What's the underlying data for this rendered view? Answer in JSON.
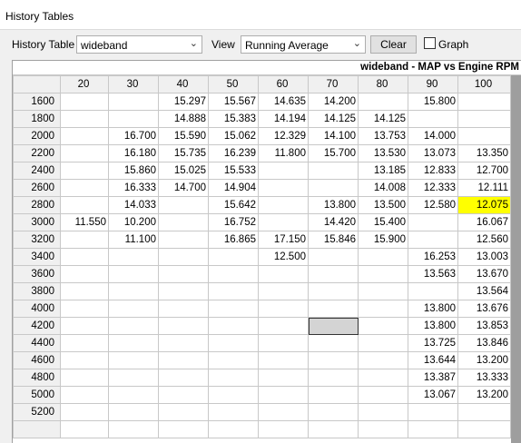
{
  "window": {
    "title": "History Tables"
  },
  "toolbar": {
    "history_table_label": "History Table",
    "history_table_value": "wideband",
    "view_label": "View",
    "view_value": "Running Average",
    "clear_label": "Clear",
    "graph_label": "Graph",
    "graph_checked": false
  },
  "table": {
    "caption": "wideband - MAP vs Engine RPM",
    "columns": [
      "20",
      "30",
      "40",
      "50",
      "60",
      "70",
      "80",
      "90",
      "100"
    ],
    "highlight_color": "#ffff00",
    "highlighted_cell": {
      "row": "2800",
      "col": "100"
    },
    "selected_cell": {
      "row": "4200",
      "col": "70"
    },
    "rows": [
      {
        "label": "1600",
        "cells": [
          "",
          "",
          "15.297",
          "15.567",
          "14.635",
          "14.200",
          "",
          "15.800",
          ""
        ]
      },
      {
        "label": "1800",
        "cells": [
          "",
          "",
          "14.888",
          "15.383",
          "14.194",
          "14.125",
          "14.125",
          "",
          ""
        ]
      },
      {
        "label": "2000",
        "cells": [
          "",
          "16.700",
          "15.590",
          "15.062",
          "12.329",
          "14.100",
          "13.753",
          "14.000",
          ""
        ]
      },
      {
        "label": "2200",
        "cells": [
          "",
          "16.180",
          "15.735",
          "16.239",
          "11.800",
          "15.700",
          "13.530",
          "13.073",
          "13.350"
        ]
      },
      {
        "label": "2400",
        "cells": [
          "",
          "15.860",
          "15.025",
          "15.533",
          "",
          "",
          "13.185",
          "12.833",
          "12.700"
        ]
      },
      {
        "label": "2600",
        "cells": [
          "",
          "16.333",
          "14.700",
          "14.904",
          "",
          "",
          "14.008",
          "12.333",
          "12.111"
        ]
      },
      {
        "label": "2800",
        "cells": [
          "",
          "14.033",
          "",
          "15.642",
          "",
          "13.800",
          "13.500",
          "12.580",
          "12.075"
        ]
      },
      {
        "label": "3000",
        "cells": [
          "11.550",
          "10.200",
          "",
          "16.752",
          "",
          "14.420",
          "15.400",
          "",
          "16.067"
        ]
      },
      {
        "label": "3200",
        "cells": [
          "",
          "11.100",
          "",
          "16.865",
          "17.150",
          "15.846",
          "15.900",
          "",
          "12.560"
        ]
      },
      {
        "label": "3400",
        "cells": [
          "",
          "",
          "",
          "",
          "12.500",
          "",
          "",
          "16.253",
          "13.003"
        ]
      },
      {
        "label": "3600",
        "cells": [
          "",
          "",
          "",
          "",
          "",
          "",
          "",
          "13.563",
          "13.670"
        ]
      },
      {
        "label": "3800",
        "cells": [
          "",
          "",
          "",
          "",
          "",
          "",
          "",
          "",
          "13.564"
        ]
      },
      {
        "label": "4000",
        "cells": [
          "",
          "",
          "",
          "",
          "",
          "",
          "",
          "13.800",
          "13.676"
        ]
      },
      {
        "label": "4200",
        "cells": [
          "",
          "",
          "",
          "",
          "",
          "",
          "",
          "13.800",
          "13.853"
        ]
      },
      {
        "label": "4400",
        "cells": [
          "",
          "",
          "",
          "",
          "",
          "",
          "",
          "13.725",
          "13.846"
        ]
      },
      {
        "label": "4600",
        "cells": [
          "",
          "",
          "",
          "",
          "",
          "",
          "",
          "13.644",
          "13.200"
        ]
      },
      {
        "label": "4800",
        "cells": [
          "",
          "",
          "",
          "",
          "",
          "",
          "",
          "13.387",
          "13.333"
        ]
      },
      {
        "label": "5000",
        "cells": [
          "",
          "",
          "",
          "",
          "",
          "",
          "",
          "13.067",
          "13.200"
        ]
      },
      {
        "label": "5200",
        "cells": [
          "",
          "",
          "",
          "",
          "",
          "",
          "",
          "",
          ""
        ]
      },
      {
        "label": "",
        "cells": [
          "",
          "",
          "",
          "",
          "",
          "",
          "",
          "",
          ""
        ]
      }
    ]
  }
}
